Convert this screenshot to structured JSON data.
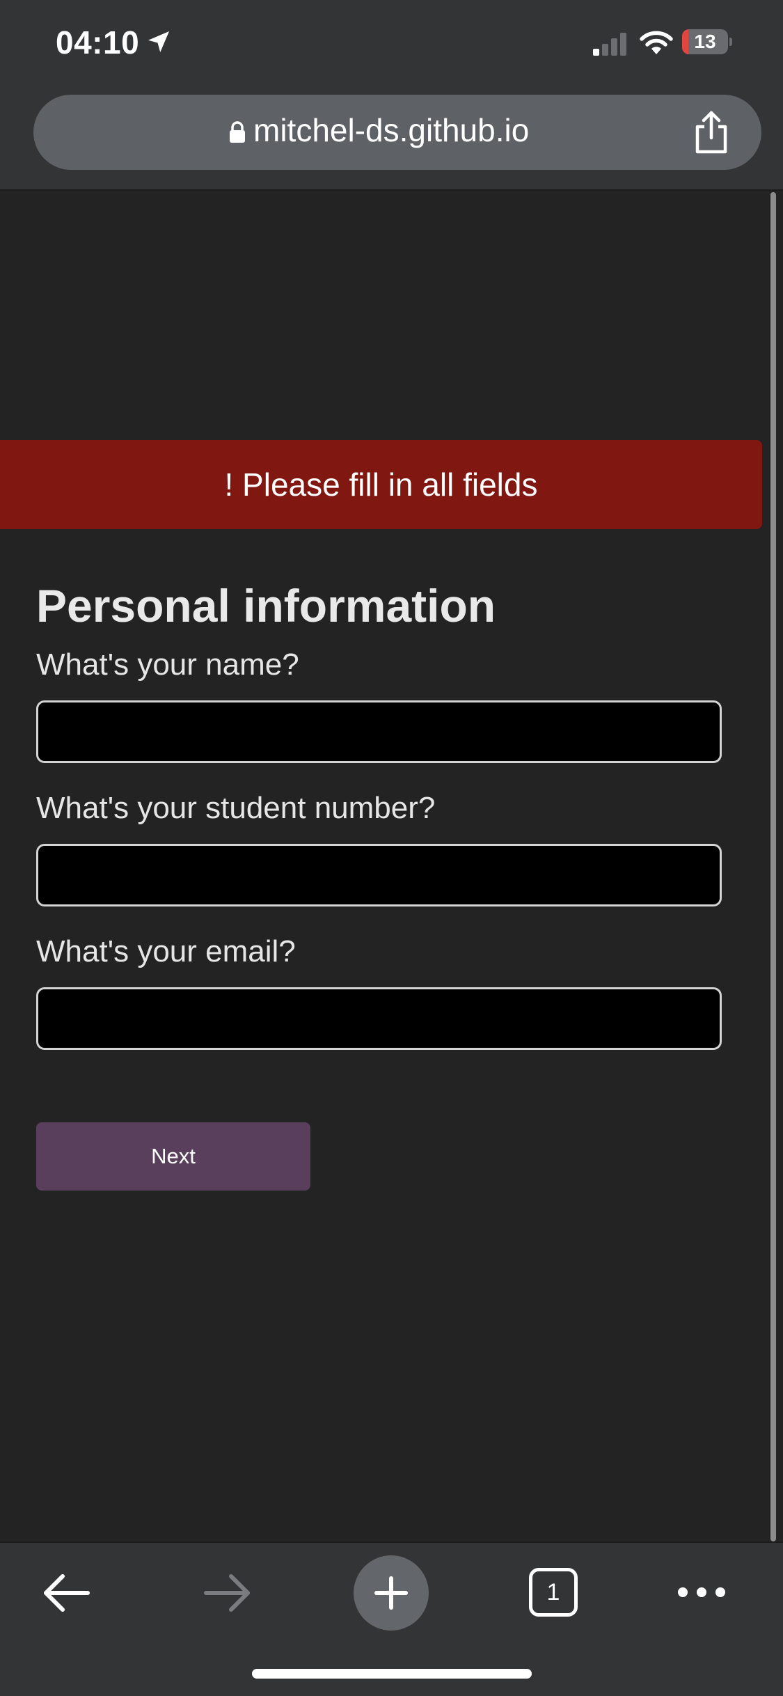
{
  "status_bar": {
    "time": "04:10",
    "battery_level": "13",
    "battery_fraction": 0.13,
    "icons": [
      "location-arrow-icon",
      "cellular-signal-icon",
      "wifi-icon",
      "battery-icon"
    ]
  },
  "browser": {
    "url": "mitchel-ds.github.io",
    "icons": [
      "lock-icon",
      "share-icon"
    ]
  },
  "error_banner": {
    "message": "! Please fill in all fields",
    "color": "#811711"
  },
  "form": {
    "title": "Personal information",
    "fields": [
      {
        "label": "What's your name?",
        "value": ""
      },
      {
        "label": "What's your student number?",
        "value": ""
      },
      {
        "label": "What's your email?",
        "value": ""
      }
    ],
    "next_label": "Next",
    "next_color": "#5a3f5c"
  },
  "toolbar": {
    "tab_count": "1",
    "icons": [
      "back-arrow-icon",
      "forward-arrow-icon",
      "plus-icon",
      "tabs-icon",
      "more-dots-icon"
    ]
  }
}
